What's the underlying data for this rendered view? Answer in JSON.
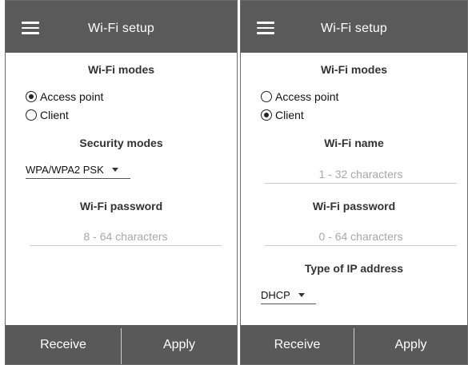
{
  "left": {
    "appbar_title": "Wi-Fi setup",
    "wifi_modes_title": "Wi-Fi modes",
    "modes": [
      {
        "label": "Access point",
        "checked": true
      },
      {
        "label": "Client",
        "checked": false
      }
    ],
    "security_title": "Security modes",
    "security_value": "WPA/WPA2 PSK",
    "password_title": "Wi-Fi password",
    "password_placeholder": "8 - 64 characters",
    "receive_label": "Receive",
    "apply_label": "Apply"
  },
  "right": {
    "appbar_title": "Wi-Fi setup",
    "wifi_modes_title": "Wi-Fi modes",
    "modes": [
      {
        "label": "Access point",
        "checked": false
      },
      {
        "label": "Client",
        "checked": true
      }
    ],
    "name_title": "Wi-Fi name",
    "name_placeholder": "1 - 32 characters",
    "password_title": "Wi-Fi password",
    "password_placeholder": "0 - 64 characters",
    "ip_title": "Type of IP address",
    "ip_value": "DHCP",
    "receive_label": "Receive",
    "apply_label": "Apply"
  }
}
